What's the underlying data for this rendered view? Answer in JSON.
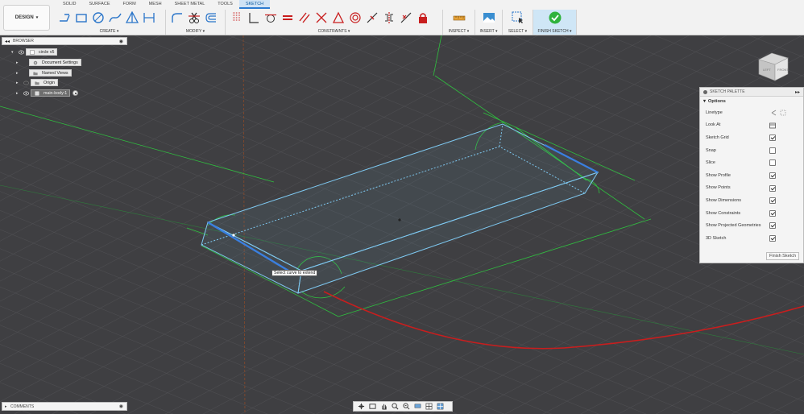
{
  "workspace": {
    "label": "DESIGN",
    "caret": "▾"
  },
  "tabs": [
    "SOLID",
    "SURFACE",
    "FORM",
    "MESH",
    "SHEET METAL",
    "TOOLS",
    "SKETCH"
  ],
  "active_tab": "SKETCH",
  "groups": {
    "create": "CREATE ▾",
    "modify": "MODIFY ▾",
    "constraints": "CONSTRAINTS ▾",
    "inspect": "INSPECT ▾",
    "insert": "INSERT ▾",
    "select": "SELECT ▾",
    "finish": "FINISH SKETCH ▾"
  },
  "browser": {
    "title": "BROWSER",
    "pin": "◉",
    "items": [
      {
        "label": "circle v5",
        "icon": "file-icon"
      },
      {
        "label": "Document Settings",
        "icon": "gear-icon"
      },
      {
        "label": "Named Views",
        "icon": "folder-icon"
      },
      {
        "label": "Origin",
        "icon": "folder-icon"
      },
      {
        "label": "main-body:1",
        "icon": "component-icon"
      }
    ]
  },
  "palette": {
    "title": "SKETCH PALETTE",
    "section": "Options",
    "rows": [
      {
        "label": "Linetype",
        "control": "linetype"
      },
      {
        "label": "Look At",
        "control": "lookat"
      },
      {
        "label": "Sketch Grid",
        "control": "checkbox",
        "checked": true
      },
      {
        "label": "Snap",
        "control": "checkbox",
        "checked": false
      },
      {
        "label": "Slice",
        "control": "checkbox",
        "checked": false
      },
      {
        "label": "Show Profile",
        "control": "checkbox",
        "checked": true
      },
      {
        "label": "Show Points",
        "control": "checkbox",
        "checked": true
      },
      {
        "label": "Show Dimensions",
        "control": "checkbox",
        "checked": true
      },
      {
        "label": "Show Constraints",
        "control": "checkbox",
        "checked": true
      },
      {
        "label": "Show Projected Geometries",
        "control": "checkbox",
        "checked": true
      },
      {
        "label": "3D Sketch",
        "control": "checkbox",
        "checked": true
      }
    ],
    "finish_button": "Finish Sketch"
  },
  "tooltip": "Select curve to extend",
  "comments": {
    "title": "COMMENTS",
    "pin": "◉",
    "arrow": "▸"
  },
  "viewcube": {
    "faces": [
      "LEFT",
      "FRONT"
    ]
  },
  "colors": {
    "viewport_bg": "#3f3f42",
    "grid": "#555558",
    "sketch_blue": "#7ec8f0",
    "dimension_green": "#2fbf3f",
    "arc_red": "#c81e1e",
    "finish_green": "#2fb23c"
  }
}
